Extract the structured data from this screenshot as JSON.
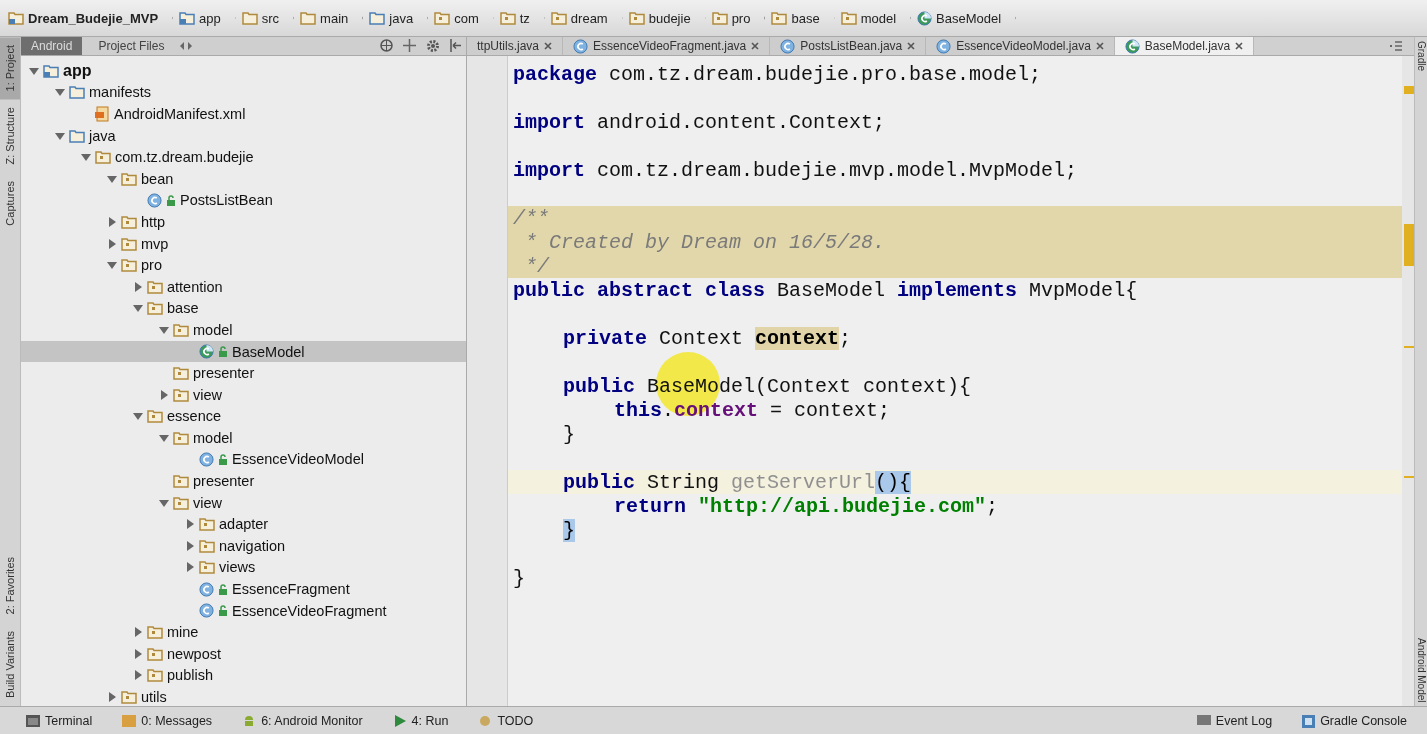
{
  "breadcrumbs": [
    {
      "label": "Dream_Budejie_MVP",
      "kind": "project"
    },
    {
      "label": "app",
      "kind": "module"
    },
    {
      "label": "src",
      "kind": "folder"
    },
    {
      "label": "main",
      "kind": "folder"
    },
    {
      "label": "java",
      "kind": "source"
    },
    {
      "label": "com",
      "kind": "package"
    },
    {
      "label": "tz",
      "kind": "package"
    },
    {
      "label": "dream",
      "kind": "package"
    },
    {
      "label": "budejie",
      "kind": "package"
    },
    {
      "label": "pro",
      "kind": "package"
    },
    {
      "label": "base",
      "kind": "package"
    },
    {
      "label": "model",
      "kind": "package"
    },
    {
      "label": "BaseModel",
      "kind": "abstract"
    }
  ],
  "left_strip": [
    {
      "label": "1: Project",
      "selected": true
    },
    {
      "label": "Z: Structure",
      "selected": false
    },
    {
      "label": "Captures",
      "selected": false
    },
    {
      "label": "2: Favorites",
      "selected": false
    },
    {
      "label": "Build Variants",
      "selected": false
    }
  ],
  "right_strip": [
    {
      "label": "Gradle"
    },
    {
      "label": "Android Model"
    }
  ],
  "panel_tabs": [
    {
      "label": "Android",
      "selected": true
    },
    {
      "label": "Project Files",
      "selected": false
    }
  ],
  "editor_tabs": [
    {
      "label": "ttpUtils.java",
      "kind": "plain",
      "selected": false
    },
    {
      "label": "EssenceVideoFragment.java",
      "kind": "class",
      "selected": false
    },
    {
      "label": "PostsListBean.java",
      "kind": "class",
      "selected": false
    },
    {
      "label": "EssenceVideoModel.java",
      "kind": "class",
      "selected": false
    },
    {
      "label": "BaseModel.java",
      "kind": "abstract",
      "selected": true
    }
  ],
  "tree": [
    {
      "label": "app",
      "kind": "module",
      "expanded": true,
      "selected": false,
      "children": [
        {
          "label": "manifests",
          "kind": "source",
          "expanded": true,
          "selected": false,
          "children": [
            {
              "label": "AndroidManifest.xml",
              "kind": "manifest",
              "selected": false
            }
          ]
        },
        {
          "label": "java",
          "kind": "source",
          "expanded": true,
          "selected": false,
          "children": [
            {
              "label": "com.tz.dream.budejie",
              "kind": "package",
              "expanded": true,
              "selected": false,
              "children": [
                {
                  "label": "bean",
                  "kind": "package",
                  "expanded": true,
                  "selected": false,
                  "children": [
                    {
                      "label": "PostsListBean",
                      "kind": "class",
                      "selected": false
                    }
                  ]
                },
                {
                  "label": "http",
                  "kind": "package",
                  "expanded": false,
                  "selected": false
                },
                {
                  "label": "mvp",
                  "kind": "package",
                  "expanded": false,
                  "selected": false
                },
                {
                  "label": "pro",
                  "kind": "package",
                  "expanded": true,
                  "selected": false,
                  "children": [
                    {
                      "label": "attention",
                      "kind": "package",
                      "expanded": false,
                      "selected": false
                    },
                    {
                      "label": "base",
                      "kind": "package",
                      "expanded": true,
                      "selected": false,
                      "children": [
                        {
                          "label": "model",
                          "kind": "package",
                          "expanded": true,
                          "selected": false,
                          "children": [
                            {
                              "label": "BaseModel",
                              "kind": "abstract",
                              "selected": true
                            }
                          ]
                        },
                        {
                          "label": "presenter",
                          "kind": "package",
                          "selected": false
                        },
                        {
                          "label": "view",
                          "kind": "package",
                          "expanded": false,
                          "selected": false
                        }
                      ]
                    },
                    {
                      "label": "essence",
                      "kind": "package",
                      "expanded": true,
                      "selected": false,
                      "children": [
                        {
                          "label": "model",
                          "kind": "package",
                          "expanded": true,
                          "selected": false,
                          "children": [
                            {
                              "label": "EssenceVideoModel",
                              "kind": "class",
                              "selected": false
                            }
                          ]
                        },
                        {
                          "label": "presenter",
                          "kind": "package",
                          "selected": false
                        },
                        {
                          "label": "view",
                          "kind": "package",
                          "expanded": true,
                          "selected": false,
                          "children": [
                            {
                              "label": "adapter",
                              "kind": "package",
                              "expanded": false,
                              "selected": false
                            },
                            {
                              "label": "navigation",
                              "kind": "package",
                              "expanded": false,
                              "selected": false
                            },
                            {
                              "label": "views",
                              "kind": "package",
                              "expanded": false,
                              "selected": false
                            },
                            {
                              "label": "EssenceFragment",
                              "kind": "class",
                              "selected": false
                            },
                            {
                              "label": "EssenceVideoFragment",
                              "kind": "class",
                              "selected": false
                            }
                          ]
                        }
                      ]
                    },
                    {
                      "label": "mine",
                      "kind": "package",
                      "expanded": false,
                      "selected": false
                    },
                    {
                      "label": "newpost",
                      "kind": "package",
                      "expanded": false,
                      "selected": false
                    },
                    {
                      "label": "publish",
                      "kind": "package",
                      "expanded": false,
                      "selected": false
                    }
                  ]
                },
                {
                  "label": "utils",
                  "kind": "package",
                  "expanded": false,
                  "selected": false
                }
              ]
            }
          ]
        }
      ]
    }
  ],
  "code": [
    {
      "kind": "top",
      "tokens": [
        {
          "kind": "kw",
          "text": "package"
        },
        {
          "kind": "plain",
          "text": " com.tz.dream.budejie.pro.base.model;"
        }
      ]
    },
    {
      "kind": "top",
      "blank_before": true,
      "tokens": [
        {
          "kind": "kw",
          "text": "import"
        },
        {
          "kind": "plain",
          "text": " android.content.Context;"
        }
      ]
    },
    {
      "kind": "top",
      "blank_before": true,
      "tokens": [
        {
          "kind": "kw",
          "text": "import"
        },
        {
          "kind": "plain",
          "text": " com.tz.dream.budejie.mvp.model.MvpModel;"
        }
      ]
    },
    {
      "kind": "top",
      "blank_before": true,
      "band": true,
      "tokens": [
        {
          "kind": "comment",
          "text": "/**"
        }
      ]
    },
    {
      "kind": "top",
      "band": true,
      "tokens": [
        {
          "kind": "comment",
          "text": " * Created by Dream on 16/5/28."
        }
      ]
    },
    {
      "kind": "top",
      "band": true,
      "tokens": [
        {
          "kind": "comment",
          "text": " */"
        }
      ]
    },
    {
      "kind": "top",
      "tokens": [
        {
          "kind": "kw",
          "text": "public abstract class"
        },
        {
          "kind": "plain",
          "text": " BaseModel "
        },
        {
          "kind": "kw",
          "text": "implements"
        },
        {
          "kind": "plain",
          "text": " MvpModel{"
        }
      ]
    },
    {
      "kind": "member",
      "blank_before": true,
      "tokens": [
        {
          "kind": "kw",
          "text": "private"
        },
        {
          "kind": "plain",
          "text": " Context "
        },
        {
          "kind": "usage",
          "text": "context"
        },
        {
          "kind": "plain",
          "text": ";"
        }
      ]
    },
    {
      "kind": "member",
      "blank_before": true,
      "tokens": [
        {
          "kind": "kw",
          "text": "public"
        },
        {
          "kind": "plain",
          "text": " BaseModel(Context context){"
        }
      ]
    },
    {
      "kind": "body",
      "tokens": [
        {
          "kind": "kw",
          "text": "this"
        },
        {
          "kind": "plain",
          "text": "."
        },
        {
          "kind": "field",
          "text": "context"
        },
        {
          "kind": "plain",
          "text": " = context;"
        }
      ]
    },
    {
      "kind": "member",
      "tokens": [
        {
          "kind": "plain",
          "text": "}"
        }
      ]
    },
    {
      "kind": "member",
      "blank_before": true,
      "current": true,
      "tokens": [
        {
          "kind": "kw",
          "text": "public"
        },
        {
          "kind": "plain",
          "text": " String "
        },
        {
          "kind": "unused",
          "text": "getServerUrl"
        },
        {
          "kind": "brace",
          "text": "(){"
        }
      ]
    },
    {
      "kind": "body",
      "tokens": [
        {
          "kind": "kw",
          "text": "return"
        },
        {
          "kind": "string",
          "text": " \"http://api.budejie.com\""
        },
        {
          "kind": "plain",
          "text": ";"
        }
      ]
    },
    {
      "kind": "member",
      "tokens": [
        {
          "kind": "brace",
          "text": "}"
        }
      ]
    },
    {
      "kind": "top",
      "blank_before": true,
      "tokens": [
        {
          "kind": "plain",
          "text": "}"
        }
      ]
    }
  ],
  "bottom_tools": [
    {
      "label": "Terminal",
      "kind": "terminal"
    },
    {
      "label": "0: Messages",
      "kind": "messages"
    },
    {
      "label": "6: Android Monitor",
      "kind": "android"
    },
    {
      "label": "4: Run",
      "kind": "run"
    },
    {
      "label": "TODO",
      "kind": "todo"
    }
  ],
  "bottom_right_tools": [
    {
      "label": "Event Log",
      "kind": "log"
    },
    {
      "label": "Gradle Console",
      "kind": "gradle"
    }
  ]
}
